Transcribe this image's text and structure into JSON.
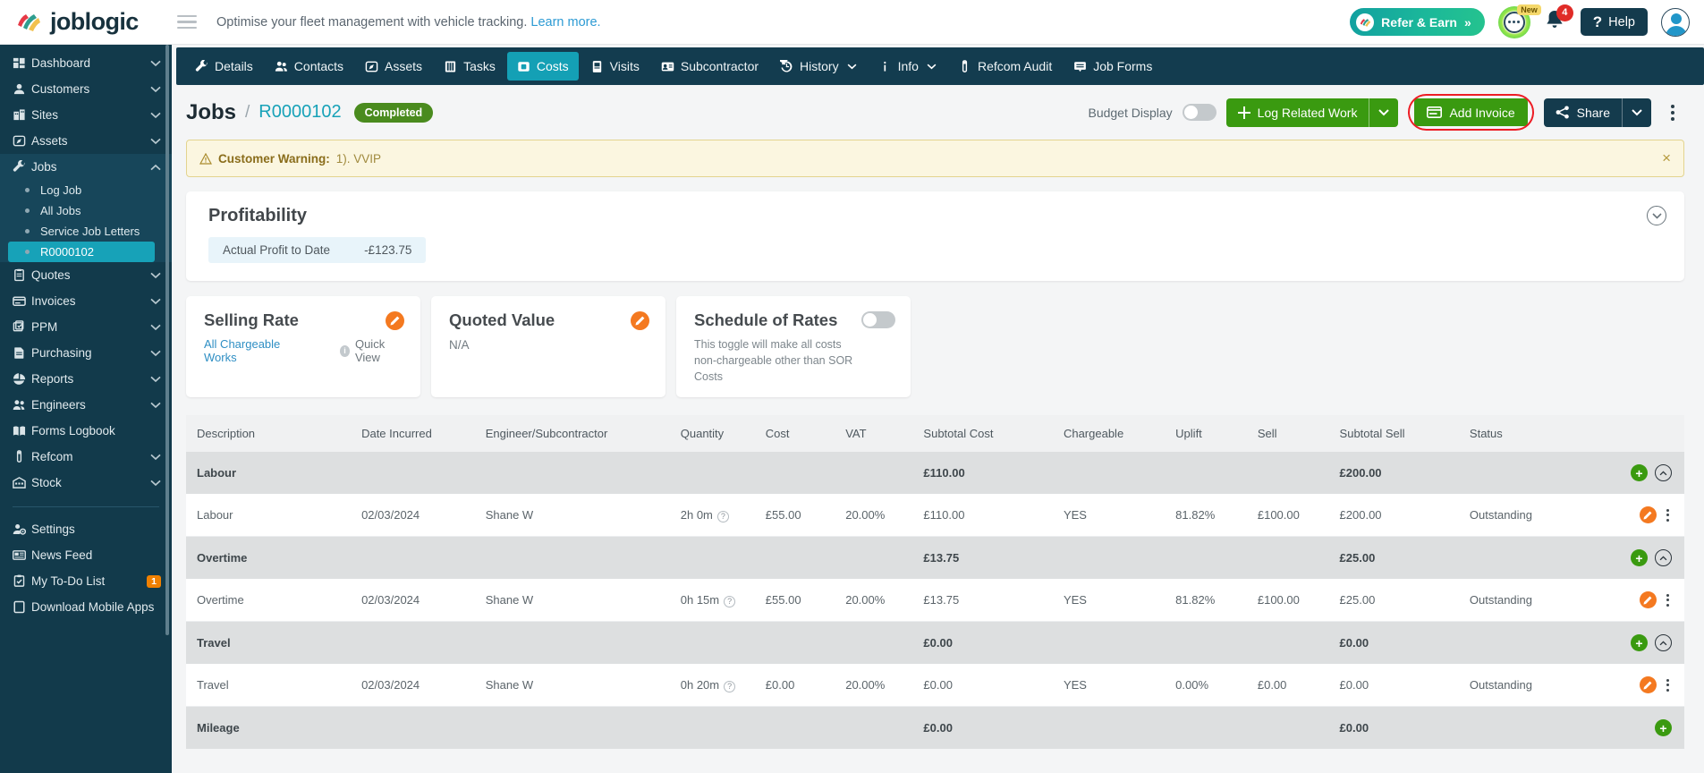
{
  "brand": {
    "name": "joblogic"
  },
  "topbar": {
    "promo_text": "Optimise your fleet management with vehicle tracking.",
    "promo_link": "Learn more.",
    "refer_label": "Refer & Earn",
    "refer_chevron": "»",
    "chat_badge": "New",
    "notification_count": "4",
    "help_label": "Help",
    "help_icon_glyph": "?"
  },
  "sidebar": {
    "items": [
      {
        "label": "Dashboard",
        "icon": "dashboard-icon",
        "expandable": true
      },
      {
        "label": "Customers",
        "icon": "customers-icon",
        "expandable": true
      },
      {
        "label": "Sites",
        "icon": "sites-icon",
        "expandable": true
      },
      {
        "label": "Assets",
        "icon": "assets-icon",
        "expandable": true
      },
      {
        "label": "Jobs",
        "icon": "wrench-icon",
        "expandable": true,
        "open": true
      },
      {
        "label": "Quotes",
        "icon": "quotes-icon",
        "expandable": true
      },
      {
        "label": "Invoices",
        "icon": "invoices-icon",
        "expandable": true
      },
      {
        "label": "PPM",
        "icon": "ppm-icon",
        "expandable": true
      },
      {
        "label": "Purchasing",
        "icon": "purchasing-icon",
        "expandable": true
      },
      {
        "label": "Reports",
        "icon": "reports-icon",
        "expandable": true
      },
      {
        "label": "Engineers",
        "icon": "engineers-icon",
        "expandable": true
      },
      {
        "label": "Forms Logbook",
        "icon": "forms-logbook-icon",
        "expandable": false
      },
      {
        "label": "Refcom",
        "icon": "refcom-icon",
        "expandable": true
      },
      {
        "label": "Stock",
        "icon": "stock-icon",
        "expandable": true
      }
    ],
    "jobs_submenu": [
      {
        "label": "Log Job",
        "active": false
      },
      {
        "label": "All Jobs",
        "active": false
      },
      {
        "label": "Service Job Letters",
        "active": false
      },
      {
        "label": "R0000102",
        "active": true
      }
    ],
    "footer_items": [
      {
        "label": "Settings",
        "icon": "settings-icon",
        "badge": ""
      },
      {
        "label": "News Feed",
        "icon": "news-feed-icon",
        "badge": ""
      },
      {
        "label": "My To-Do List",
        "icon": "todo-icon",
        "badge": "1"
      },
      {
        "label": "Download Mobile Apps",
        "icon": "mobile-apps-icon",
        "badge": ""
      }
    ]
  },
  "tabs": [
    {
      "label": "Details",
      "icon": "wrench-icon",
      "active": false,
      "caret": false
    },
    {
      "label": "Contacts",
      "icon": "contacts-icon",
      "active": false,
      "caret": false
    },
    {
      "label": "Assets",
      "icon": "assets-icon",
      "active": false,
      "caret": false
    },
    {
      "label": "Tasks",
      "icon": "tasks-icon",
      "active": false,
      "caret": false
    },
    {
      "label": "Costs",
      "icon": "costs-icon",
      "active": true,
      "caret": false
    },
    {
      "label": "Visits",
      "icon": "visits-icon",
      "active": false,
      "caret": false
    },
    {
      "label": "Subcontractor",
      "icon": "subcontractor-icon",
      "active": false,
      "caret": false
    },
    {
      "label": "History",
      "icon": "history-icon",
      "active": false,
      "caret": true
    },
    {
      "label": "Info",
      "icon": "info-icon",
      "active": false,
      "caret": true
    },
    {
      "label": "Refcom Audit",
      "icon": "refcom-icon",
      "active": false,
      "caret": false
    },
    {
      "label": "Job Forms",
      "icon": "job-forms-icon",
      "active": false,
      "caret": false
    }
  ],
  "page": {
    "breadcrumb_root": "Jobs",
    "breadcrumb_sep": "/",
    "breadcrumb_id": "R0000102",
    "status_pill": "Completed",
    "budget_display_label": "Budget Display",
    "budget_display_on": false,
    "log_related_work_label": "Log Related Work",
    "add_invoice_label": "Add Invoice",
    "share_label": "Share"
  },
  "warning": {
    "title": "Customer Warning:",
    "text": "1). VVIP",
    "close_glyph": "×"
  },
  "profitability": {
    "title": "Profitability",
    "metric_label": "Actual Profit to Date",
    "metric_value": "-£123.75"
  },
  "cards": {
    "selling_rate": {
      "title": "Selling Rate",
      "link": "All Chargeable Works",
      "quick_view": "Quick View"
    },
    "quoted_value": {
      "title": "Quoted Value",
      "value": "N/A"
    },
    "schedule_of_rates": {
      "title": "Schedule of Rates",
      "description": "This toggle will make all costs non-chargeable other than SOR Costs",
      "toggle_on": false
    }
  },
  "costs_table": {
    "columns": [
      "Description",
      "Date Incurred",
      "Engineer/Subcontractor",
      "Quantity",
      "Cost",
      "VAT",
      "Subtotal Cost",
      "Chargeable",
      "Uplift",
      "Sell",
      "Subtotal Sell",
      "Status"
    ],
    "rows": [
      {
        "type": "group",
        "description": "Labour",
        "date": "",
        "engineer": "",
        "quantity": "",
        "cost": "",
        "vat": "",
        "subtotal_cost": "£110.00",
        "chargeable": "",
        "uplift": "",
        "sell": "",
        "subtotal_sell": "£200.00",
        "status": ""
      },
      {
        "type": "data",
        "description": "Labour",
        "date": "02/03/2024",
        "engineer": "Shane W",
        "quantity": "2h 0m",
        "cost": "£55.00",
        "vat": "20.00%",
        "subtotal_cost": "£110.00",
        "chargeable": "YES",
        "uplift": "81.82%",
        "sell": "£100.00",
        "subtotal_sell": "£200.00",
        "status": "Outstanding"
      },
      {
        "type": "group",
        "description": "Overtime",
        "date": "",
        "engineer": "",
        "quantity": "",
        "cost": "",
        "vat": "",
        "subtotal_cost": "£13.75",
        "chargeable": "",
        "uplift": "",
        "sell": "",
        "subtotal_sell": "£25.00",
        "status": ""
      },
      {
        "type": "data",
        "description": "Overtime",
        "date": "02/03/2024",
        "engineer": "Shane W",
        "quantity": "0h 15m",
        "cost": "£55.00",
        "vat": "20.00%",
        "subtotal_cost": "£13.75",
        "chargeable": "YES",
        "uplift": "81.82%",
        "sell": "£100.00",
        "subtotal_sell": "£25.00",
        "status": "Outstanding"
      },
      {
        "type": "group",
        "description": "Travel",
        "date": "",
        "engineer": "",
        "quantity": "",
        "cost": "",
        "vat": "",
        "subtotal_cost": "£0.00",
        "chargeable": "",
        "uplift": "",
        "sell": "",
        "subtotal_sell": "£0.00",
        "status": ""
      },
      {
        "type": "data",
        "description": "Travel",
        "date": "02/03/2024",
        "engineer": "Shane W",
        "quantity": "0h 20m",
        "cost": "£0.00",
        "vat": "20.00%",
        "subtotal_cost": "£0.00",
        "chargeable": "YES",
        "uplift": "0.00%",
        "sell": "£0.00",
        "subtotal_sell": "£0.00",
        "status": "Outstanding"
      },
      {
        "type": "group",
        "description": "Mileage",
        "date": "",
        "engineer": "",
        "quantity": "",
        "cost": "",
        "vat": "",
        "subtotal_cost": "£0.00",
        "chargeable": "",
        "uplift": "",
        "sell": "",
        "subtotal_sell": "£0.00",
        "status": ""
      }
    ]
  },
  "colors": {
    "sidebar_bg": "#123a4b",
    "tabbar_bg": "#133c4f",
    "accent_teal": "#17a2b8",
    "green_button": "#3a9a10",
    "orange": "#f47920",
    "highlight_ring": "#ed1c24",
    "status_pill": "#4a8b1e"
  }
}
